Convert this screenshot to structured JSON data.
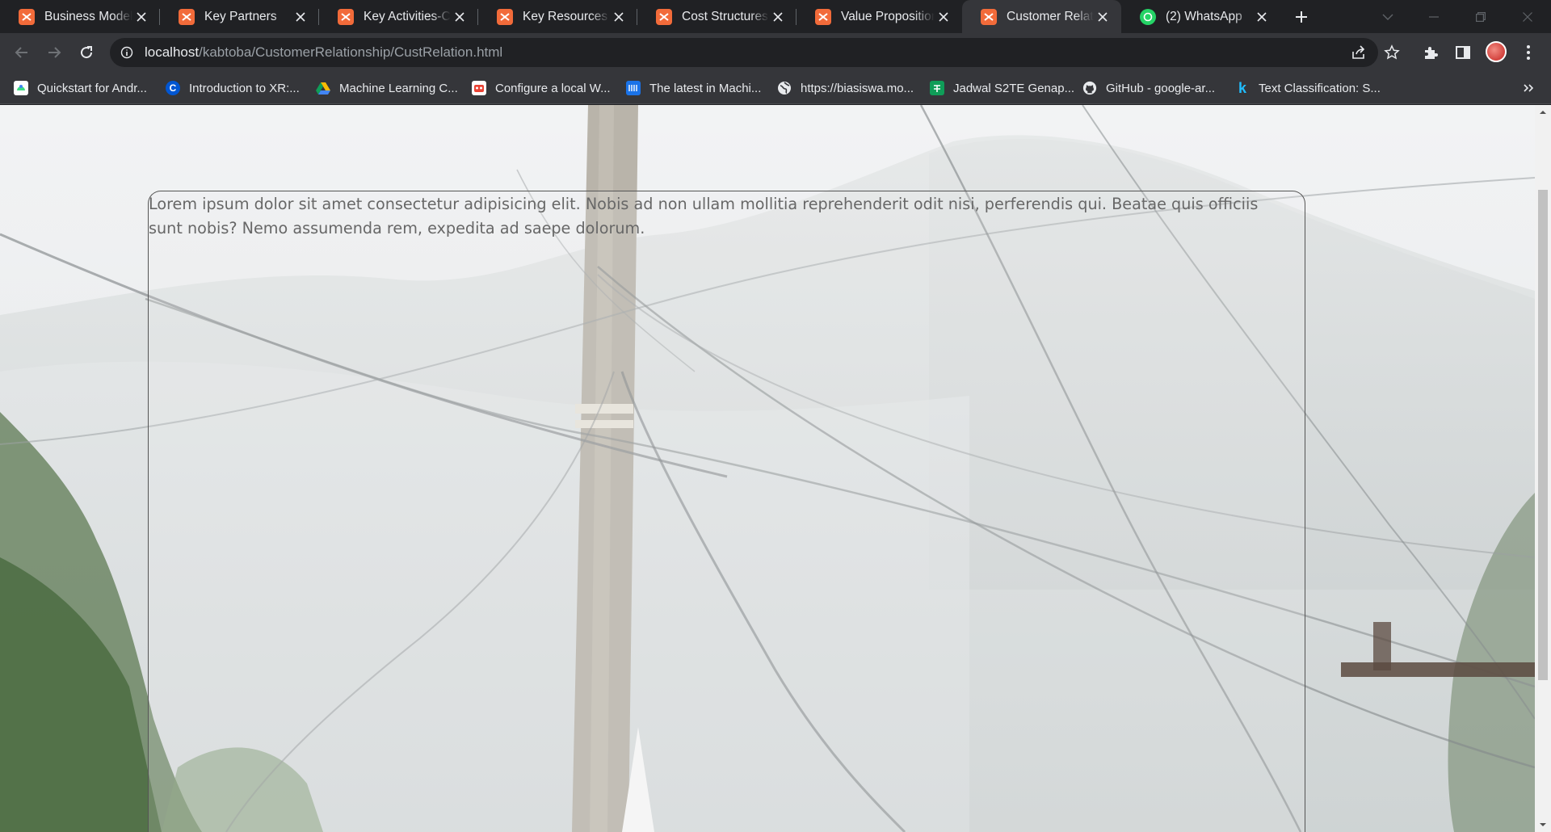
{
  "browser": {
    "tabs": [
      {
        "title": "Business Model Canvas",
        "icon": "xampp-icon",
        "active": false
      },
      {
        "title": "Key Partners",
        "icon": "xampp-icon",
        "active": false
      },
      {
        "title": "Key Activities-Company",
        "icon": "xampp-icon",
        "active": false
      },
      {
        "title": "Key Resources",
        "icon": "xampp-icon",
        "active": false
      },
      {
        "title": "Cost Structures",
        "icon": "xampp-icon",
        "active": false
      },
      {
        "title": "Value Proposition",
        "icon": "xampp-icon",
        "active": true,
        "note": ""
      },
      {
        "title": "Customer Relationship",
        "icon": "xampp-icon",
        "active": true
      },
      {
        "title": "(2) WhatsApp",
        "icon": "whatsapp-icon",
        "active": false
      }
    ],
    "address_bar": {
      "host": "localhost",
      "path": "/kabtoba/CustomerRelationship/CustRelation.html"
    },
    "bookmarks": [
      {
        "label": "Quickstart for Andr...",
        "icon": "android-icon",
        "color": "#4285f4"
      },
      {
        "label": "Introduction to XR:...",
        "icon": "coursera-icon",
        "color": "#0056d2"
      },
      {
        "label": "Machine Learning C...",
        "icon": "drive-icon",
        "color": "#fbbc04"
      },
      {
        "label": "Configure a local W...",
        "icon": "robot-icon",
        "color": "#ea4335"
      },
      {
        "label": "The latest in Machi...",
        "icon": "news-icon",
        "color": "#1a73e8"
      },
      {
        "label": "https://biasiswa.mo...",
        "icon": "globe-icon",
        "color": "#5f6368"
      },
      {
        "label": "Jadwal S2TE Genap...",
        "icon": "sheets-icon",
        "color": "#0f9d58"
      },
      {
        "label": "GitHub - google-ar...",
        "icon": "github-icon",
        "color": "#24292e"
      },
      {
        "label": "Text Classification: S...",
        "icon": "kaggle-icon",
        "color": "#20beff"
      }
    ]
  },
  "page": {
    "body_text": "Lorem ipsum dolor sit amet consectetur adipisicing elit. Nobis ad non ullam mollitia reprehenderit odit nisi, perferendis qui. Beatae quis officiis sunt nobis? Nemo assumenda rem, expedita ad saepe dolorum."
  }
}
